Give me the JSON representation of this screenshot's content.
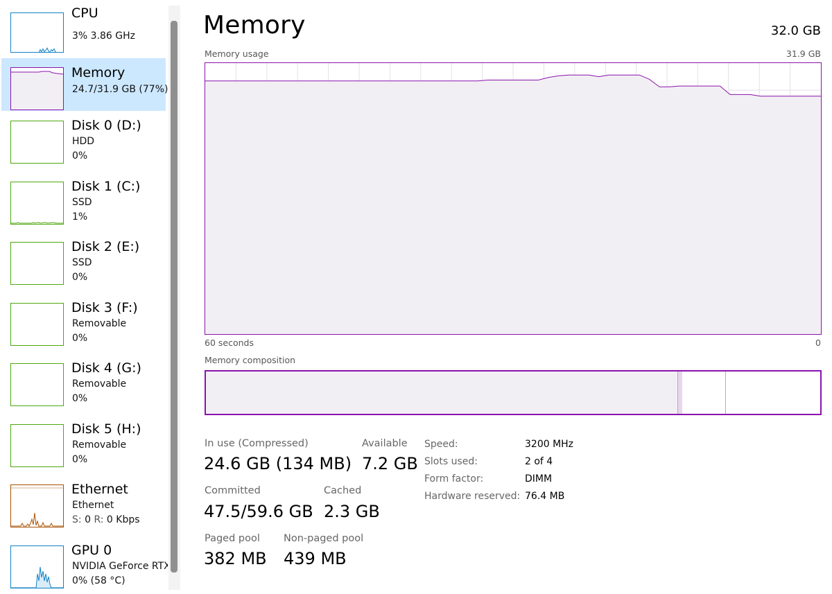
{
  "colors": {
    "memory": "#8b12ae",
    "memory_fill": "#f2eff4",
    "cpu": "#1180c4",
    "disk": "#4da60c",
    "ethernet": "#a74f01",
    "gpu": "#1180c4",
    "selected_bg": "#cce8ff",
    "grid": "#e5dfe8"
  },
  "sidebar": {
    "items": [
      {
        "title": "CPU",
        "line1": "3%  3.86 GHz",
        "line2": "",
        "color": "cpu"
      },
      {
        "title": "Memory",
        "line1": "24.7/31.9 GB (77%)",
        "line2": "",
        "color": "memory",
        "selected": true
      },
      {
        "title": "Disk 0 (D:)",
        "line1": "HDD",
        "line2": "0%",
        "color": "disk"
      },
      {
        "title": "Disk 1 (C:)",
        "line1": "SSD",
        "line2": "1%",
        "color": "disk"
      },
      {
        "title": "Disk 2 (E:)",
        "line1": "SSD",
        "line2": "0%",
        "color": "disk"
      },
      {
        "title": "Disk 3 (F:)",
        "line1": "Removable",
        "line2": "0%",
        "color": "disk"
      },
      {
        "title": "Disk 4 (G:)",
        "line1": "Removable",
        "line2": "0%",
        "color": "disk"
      },
      {
        "title": "Disk 5 (H:)",
        "line1": "Removable",
        "line2": "0%",
        "color": "disk"
      },
      {
        "title": "Ethernet",
        "line1": "Ethernet",
        "line2_s": "S:",
        "line2_sv": "0",
        "line2_r": "R:",
        "line2_rv": "0 Kbps",
        "color": "ethernet"
      },
      {
        "title": "GPU 0",
        "line1": "NVIDIA GeForce RTX",
        "line2": "0%  (58 °C)",
        "color": "gpu"
      }
    ]
  },
  "main": {
    "title": "Memory",
    "total": "32.0 GB",
    "usage_label": "Memory usage",
    "usage_max": "31.9 GB",
    "time_left": "60 seconds",
    "time_right": "0",
    "composition_label": "Memory composition",
    "usage_series_gb": [
      29.8,
      29.8,
      29.8,
      29.8,
      29.8,
      29.8,
      29.8,
      29.8,
      29.8,
      29.8,
      29.8,
      29.8,
      29.8,
      29.8,
      29.8,
      29.8,
      29.8,
      29.8,
      29.8,
      29.8,
      29.8,
      29.8,
      29.8,
      29.8,
      29.8,
      29.8,
      29.8,
      29.8,
      29.9,
      29.9,
      29.9,
      29.9,
      29.9,
      29.9,
      30.2,
      30.4,
      30.5,
      30.5,
      30.5,
      30.3,
      30.5,
      30.5,
      30.5,
      30.5,
      30.0,
      29.1,
      29.1,
      29.2,
      29.2,
      29.2,
      29.2,
      29.2,
      28.2,
      28.2,
      28.2,
      28.0,
      28.0,
      28.0,
      28.0,
      28.0,
      28.0,
      28.0
    ],
    "composition": {
      "in_use_gb": 24.6,
      "modified_gb": 0.2,
      "standby_gb": 2.3,
      "free_gb": 4.9
    }
  },
  "stats": {
    "in_use_label": "In use (Compressed)",
    "in_use_value": "24.6 GB (134 MB)",
    "available_label": "Available",
    "available_value": "7.2 GB",
    "committed_label": "Committed",
    "committed_value": "47.5/59.6 GB",
    "cached_label": "Cached",
    "cached_value": "2.3 GB",
    "paged_label": "Paged pool",
    "paged_value": "382 MB",
    "nonpaged_label": "Non-paged pool",
    "nonpaged_value": "439 MB"
  },
  "properties": {
    "speed_label": "Speed:",
    "speed_value": "3200 MHz",
    "slots_label": "Slots used:",
    "slots_value": "2 of 4",
    "form_label": "Form factor:",
    "form_value": "DIMM",
    "reserved_label": "Hardware reserved:",
    "reserved_value": "76.4 MB"
  }
}
